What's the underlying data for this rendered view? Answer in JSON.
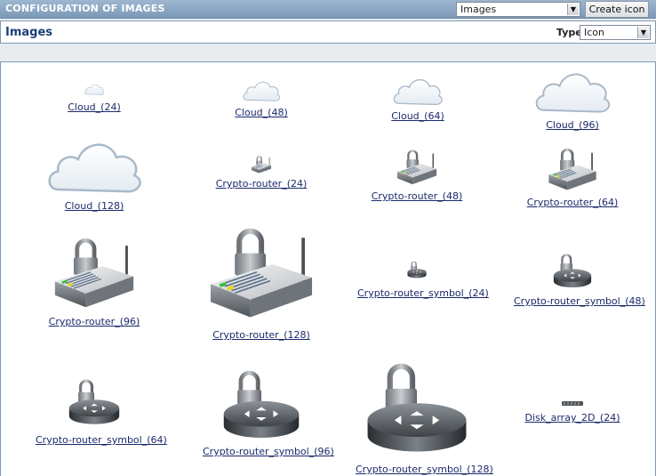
{
  "header": {
    "title": "CONFIGURATION OF IMAGES",
    "view_select": "Images",
    "create_button": "Create icon"
  },
  "subheader": {
    "title": "Images",
    "type_label": "Type",
    "type_select": "Icon"
  },
  "images": [
    {
      "label": "Cloud_(24)",
      "icon": "cloud"
    },
    {
      "label": "Cloud_(48)",
      "icon": "cloud"
    },
    {
      "label": "Cloud_(64)",
      "icon": "cloud"
    },
    {
      "label": "Cloud_(96)",
      "icon": "cloud"
    },
    {
      "label": "Cloud_(128)",
      "icon": "cloud"
    },
    {
      "label": "Crypto-router_(24)",
      "icon": "crypto-router"
    },
    {
      "label": "Crypto-router_(48)",
      "icon": "crypto-router"
    },
    {
      "label": "Crypto-router_(64)",
      "icon": "crypto-router"
    },
    {
      "label": "Crypto-router_(96)",
      "icon": "crypto-router"
    },
    {
      "label": "Crypto-router_(128)",
      "icon": "crypto-router"
    },
    {
      "label": "Crypto-router_symbol_(24)",
      "icon": "crypto-router-symbol"
    },
    {
      "label": "Crypto-router_symbol_(48)",
      "icon": "crypto-router-symbol"
    },
    {
      "label": "Crypto-router_symbol_(64)",
      "icon": "crypto-router-symbol"
    },
    {
      "label": "Crypto-router_symbol_(96)",
      "icon": "crypto-router-symbol"
    },
    {
      "label": "Crypto-router_symbol_(128)",
      "icon": "crypto-router-symbol"
    },
    {
      "label": "Disk_array_2D_(24)",
      "icon": "disk-array"
    }
  ]
}
